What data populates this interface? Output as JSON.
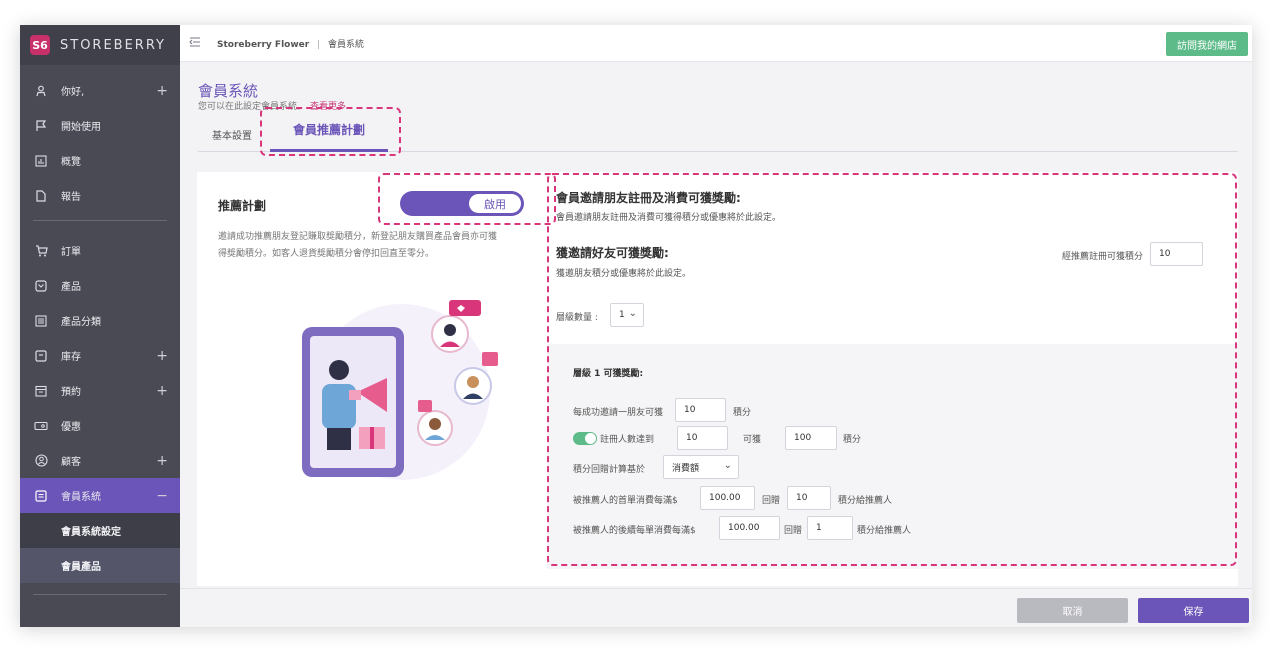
{
  "brand": {
    "logo_text": "S6",
    "name": "STOREBERRY"
  },
  "sidebar": {
    "items": [
      {
        "label": "你好,",
        "icon": "user-icon",
        "expandable": true
      },
      {
        "label": "開始使用",
        "icon": "flag-icon",
        "expandable": false
      },
      {
        "label": "概覽",
        "icon": "chart-icon",
        "expandable": false
      },
      {
        "label": "報告",
        "icon": "file-icon",
        "expandable": false
      },
      {
        "label": "訂單",
        "icon": "cart-icon",
        "expandable": false
      },
      {
        "label": "產品",
        "icon": "tag-icon",
        "expandable": false
      },
      {
        "label": "產品分類",
        "icon": "list-icon",
        "expandable": false
      },
      {
        "label": "庫存",
        "icon": "box-icon",
        "expandable": true
      },
      {
        "label": "預約",
        "icon": "calendar-icon",
        "expandable": true
      },
      {
        "label": "優惠",
        "icon": "ticket-icon",
        "expandable": false
      },
      {
        "label": "顧客",
        "icon": "customer-icon",
        "expandable": true
      },
      {
        "label": "會員系統",
        "icon": "member-icon",
        "expandable": true,
        "active": true
      }
    ],
    "sub_items": [
      "會員系統設定",
      "會員產品"
    ],
    "plus": "+",
    "minus": "−"
  },
  "header": {
    "breadcrumb_store": "Storeberry Flower",
    "breadcrumb_sep": "|",
    "breadcrumb_page": "會員系統",
    "visit_label": "訪問我的網店"
  },
  "page": {
    "title": "會員系統",
    "description": "您可以在此設定會員系統。",
    "learn_more": "查看更多",
    "tabs": {
      "basic": "基本設置",
      "referral": "會員推薦計劃"
    }
  },
  "referral": {
    "title": "推薦計劃",
    "toggle_label": "啟用",
    "description": "邀請成功推薦朋友登記賺取獎勵積分，新登記朋友購買產品會員亦可獲得獎勵積分。如客人退貨獎勵積分會停扣回直至零分。"
  },
  "reward": {
    "section1_title": "會員邀請朋友註冊及消費可獲獎勵:",
    "section1_desc": "會員邀請朋友註冊及消費可獲得積分或優惠將於此設定。",
    "section2_title": "獲邀請好友可獲獎勵:",
    "section2_desc": "獲邀朋友積分或優惠將於此設定。",
    "register_label": "經推薦註冊可獲積分",
    "register_value": "10",
    "levels_label": "層級數量 :",
    "levels_value": "1"
  },
  "tier": {
    "title": "層級 1 可獲獎勵:",
    "row1_label": "每成功邀請一朋友可獲",
    "row1_value": "10",
    "row1_unit": "積分",
    "row2_label": "註冊人數達到",
    "row2_value": "10",
    "row2_mid": "可獲",
    "row2_points": "100",
    "row2_unit": "積分",
    "row3_label": "積分回贈計算基於",
    "row3_value": "消費額",
    "row4_label": "被推薦人的首單消費每滿$",
    "row4_amount": "100.00",
    "row4_mid": "回贈",
    "row4_points": "10",
    "row4_unit": "積分給推薦人",
    "row5_label": "被推薦人的後續每單消費每滿$",
    "row5_amount": "100.00",
    "row5_mid": "回贈",
    "row5_points": "1",
    "row5_unit": "積分給推薦人"
  },
  "footer": {
    "cancel": "取消",
    "save": "保存"
  },
  "colors": {
    "accent": "#6b55b8",
    "green": "#5dbb8a",
    "highlight": "#d9357a",
    "sidebar": "#4a4a55"
  }
}
